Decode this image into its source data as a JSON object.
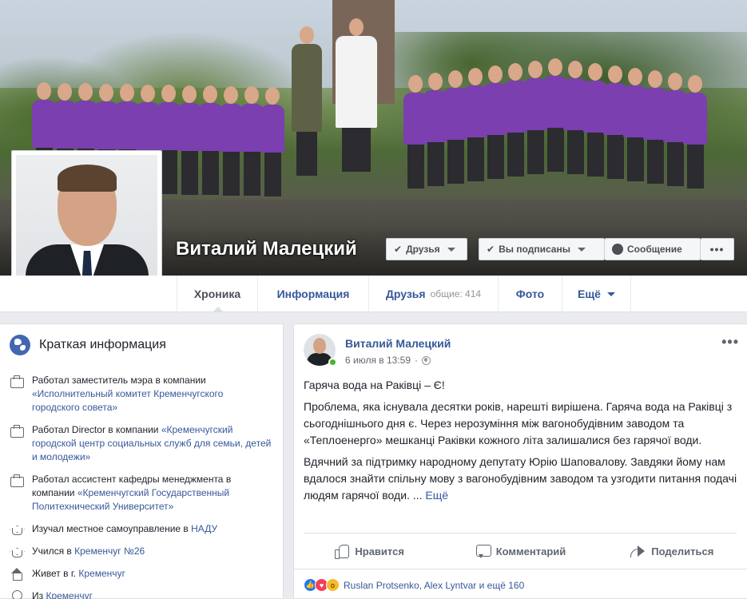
{
  "profile": {
    "name": "Виталий Малецкий",
    "buttons": {
      "friends": "Друзья",
      "subscribed": "Вы подписаны",
      "message": "Сообщение",
      "more": "•••"
    }
  },
  "tabs": [
    {
      "label": "Хроника"
    },
    {
      "label": "Информация"
    },
    {
      "label": "Друзья",
      "sub": "общие: 414"
    },
    {
      "label": "Фото"
    },
    {
      "label": "Ещё"
    }
  ],
  "intro": {
    "title": "Краткая информация",
    "items": [
      {
        "icon": "briefcase-icon",
        "prefix": "Работал заместитель мэра в компании ",
        "link": "«Исполнительный комитет Кременчугского городского совета»",
        "suffix": ""
      },
      {
        "icon": "briefcase-icon",
        "prefix": "Работал Director в компании ",
        "link": "«Кременчугский городской центр социальных служб для семьи, детей и молодежи»",
        "suffix": ""
      },
      {
        "icon": "briefcase-icon",
        "prefix": "Работал ассистент кафедры менеджмента в компании ",
        "link": "«Кременчугский Государственный Политехнический Университет»",
        "suffix": ""
      },
      {
        "icon": "graduation-cap-icon",
        "prefix": "Изучал местное самоуправление в ",
        "link": "НАДУ",
        "suffix": ""
      },
      {
        "icon": "graduation-cap-icon",
        "prefix": "Учился в ",
        "link": "Кременчуг №26",
        "suffix": ""
      },
      {
        "icon": "home-icon",
        "prefix": "Живет в г. ",
        "link": "Кременчуг",
        "suffix": ""
      },
      {
        "icon": "location-pin-icon",
        "prefix": "Из ",
        "link": "Кременчуг",
        "suffix": ""
      }
    ]
  },
  "post": {
    "author": "Виталий Малецкий",
    "date": "6 июля в 13:59",
    "dots": "•••",
    "paragraphs": [
      "Гаряча вода на Раківці – Є!",
      "Проблема, яка існувала десятки років, нарешті вирішена. Гаряча вода на Раківці з сьогоднішнього дня є. Через нерозуміння між вагонобудівним заводом та «Теплоенерго» мешканці Раківки кожного літа залишалися без гарячої води.",
      "Вдячний за підтримку народному депутату Юрію Шаповалову. Завдяки йому нам вдалося знайти спільну мову з вагонобудівним заводом та узгодити питання подачі людям гарячої води. ..."
    ],
    "see_more": "Ещё",
    "actions": {
      "like": "Нравится",
      "comment": "Комментарий",
      "share": "Поделиться"
    },
    "reactions_text": "Ruslan Protsenko, Alex Lyntvar и ещё 160"
  },
  "colors": {
    "link": "#365899",
    "accent": "#4267b2",
    "background": "#e9ebee",
    "online": "#42b72a"
  }
}
